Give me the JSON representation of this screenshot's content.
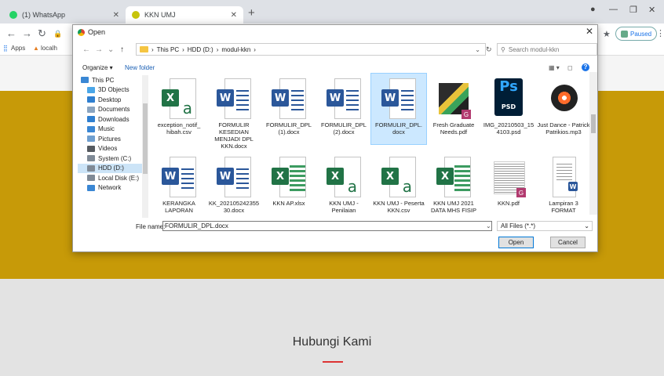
{
  "browser": {
    "tabs": [
      {
        "label": "(1) WhatsApp",
        "color": "#25d366"
      },
      {
        "label": "KKN UMJ",
        "color": "#c7c40a"
      }
    ],
    "new_tab": "+",
    "paused_label": "Paused",
    "bookmarks": [
      "Apps",
      "localh"
    ]
  },
  "dialog": {
    "title": "Open",
    "breadcrumb": [
      "This PC",
      "HDD (D:)",
      "modul-kkn"
    ],
    "search_placeholder": "Search modul-kkn",
    "organize": "Organize ▾",
    "new_folder": "New folder",
    "nav_items": [
      {
        "label": "This PC",
        "icon": "computer-icon",
        "color": "#3a87d4"
      },
      {
        "label": "3D Objects",
        "icon": "cube-icon",
        "color": "#4aa6e8"
      },
      {
        "label": "Desktop",
        "icon": "desktop-icon",
        "color": "#2f7fd0"
      },
      {
        "label": "Documents",
        "icon": "document-icon",
        "color": "#8aa4c0"
      },
      {
        "label": "Downloads",
        "icon": "download-icon",
        "color": "#2f7fd0"
      },
      {
        "label": "Music",
        "icon": "music-icon",
        "color": "#3a87d4"
      },
      {
        "label": "Pictures",
        "icon": "picture-icon",
        "color": "#6f9fcf"
      },
      {
        "label": "Videos",
        "icon": "video-icon",
        "color": "#555a60"
      },
      {
        "label": "System (C:)",
        "icon": "drive-icon",
        "color": "#7f8a96"
      },
      {
        "label": "HDD (D:)",
        "icon": "drive-icon",
        "color": "#7f8a96"
      },
      {
        "label": "Local Disk (E:)",
        "icon": "drive-icon",
        "color": "#7f8a96"
      },
      {
        "label": "Network",
        "icon": "network-icon",
        "color": "#3a87d4"
      }
    ],
    "files": [
      {
        "name": "exception_notif_ hibah.csv",
        "type": "csv"
      },
      {
        "name": "FORMULIR KESEDIAN MENJADI DPL KKN.docx",
        "type": "word"
      },
      {
        "name": "FORMULIR_DPL (1).docx",
        "type": "word"
      },
      {
        "name": "FORMULIR_DPL (2).docx",
        "type": "word"
      },
      {
        "name": "FORMULIR_DPL. docx",
        "type": "word",
        "selected": true
      },
      {
        "name": "Fresh Graduate Needs.pdf",
        "type": "pdf-img"
      },
      {
        "name": "IMG_20210503_15 4103.psd",
        "type": "psd"
      },
      {
        "name": "Just Dance - Patrick Patrikios.mp3",
        "type": "mp3"
      },
      {
        "name": "KERANGKA LAPORAN",
        "type": "word"
      },
      {
        "name": "KK_202105242355 30.docx",
        "type": "word"
      },
      {
        "name": "KKN AP.xlsx",
        "type": "excel"
      },
      {
        "name": "KKN UMJ - Penilaian",
        "type": "csv"
      },
      {
        "name": "KKN UMJ - Peserta KKN.csv",
        "type": "csv"
      },
      {
        "name": "KKN UMJ 2021 DATA MHS FISIP",
        "type": "excel"
      },
      {
        "name": "KKN.pdf",
        "type": "pdf-doc"
      },
      {
        "name": "Lampiran 3 FORMAT",
        "type": "word-doc"
      }
    ],
    "filename_label": "File name:",
    "filename_value": "FORMULIR_DPL.docx",
    "filetype_value": "All Files (*.*)",
    "open_label": "Open",
    "cancel_label": "Cancel"
  },
  "page": {
    "contact_title": "Hubungi Kami",
    "colors": {
      "header": "#c79a08",
      "accent": "#d33333"
    }
  }
}
